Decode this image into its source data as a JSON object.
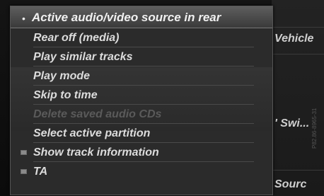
{
  "header": {
    "title": "Active audio/video source in rear"
  },
  "menu": {
    "items": [
      {
        "label": "Rear off (media)",
        "enabled": true,
        "checkbox": false
      },
      {
        "label": "Play similar tracks",
        "enabled": true,
        "checkbox": false
      },
      {
        "label": "Play mode",
        "enabled": true,
        "checkbox": false
      },
      {
        "label": "Skip to time",
        "enabled": true,
        "checkbox": false
      },
      {
        "label": "Delete saved audio CDs",
        "enabled": false,
        "checkbox": false
      },
      {
        "label": "Select active partition",
        "enabled": true,
        "checkbox": false
      },
      {
        "label": "Show track information",
        "enabled": true,
        "checkbox": true
      },
      {
        "label": "TA",
        "enabled": true,
        "checkbox": true
      }
    ]
  },
  "background": {
    "vehicle_label": "Vehicle",
    "switch_label": "' Swi...",
    "sources_label": "Sourc"
  },
  "watermark": "P82.86-8965-31"
}
